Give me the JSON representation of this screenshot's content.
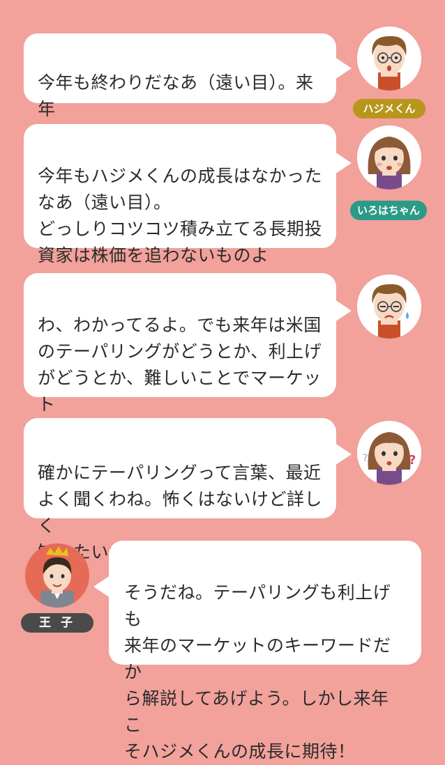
{
  "colors": {
    "background": "#f2a19b",
    "bubble": "#ffffff",
    "hajime_tag": "#b8961e",
    "iroha_tag": "#2b9a86",
    "ouji_tag": "#4a4a4a"
  },
  "characters": {
    "hajime": {
      "name": "ハジメくん",
      "icon": "hajime-avatar"
    },
    "iroha": {
      "name": "いろはちゃん",
      "icon": "iroha-avatar"
    },
    "ouji": {
      "name": "王 子",
      "icon": "ouji-avatar"
    }
  },
  "messages": [
    {
      "speaker": "hajime",
      "text": "今年も終わりだなあ（遠い目）。来年\nの株価はどうなるんだろう……"
    },
    {
      "speaker": "iroha",
      "text": "今年もハジメくんの成長はなかった\nなあ（遠い目）。\nどっしりコツコツ積み立てる長期投\n資家は株価を追わないものよ"
    },
    {
      "speaker": "hajime",
      "text": "わ、わかってるよ。でも来年は米国\nのテーパリングがどうとか、利上げ\nがどうとか、難しいことでマーケット\nが動くって怖くない？"
    },
    {
      "speaker": "iroha",
      "text": "確かにテーパリングって言葉、最近\nよく聞くわね。怖くはないけど詳しく\n知りたいわ、王子"
    },
    {
      "speaker": "ouji",
      "text": "そうだね。テーパリングも利上げも\n来年のマーケットのキーワードだか\nら解説してあげよう。しかし来年こ\nそハジメくんの成長に期待！"
    }
  ]
}
